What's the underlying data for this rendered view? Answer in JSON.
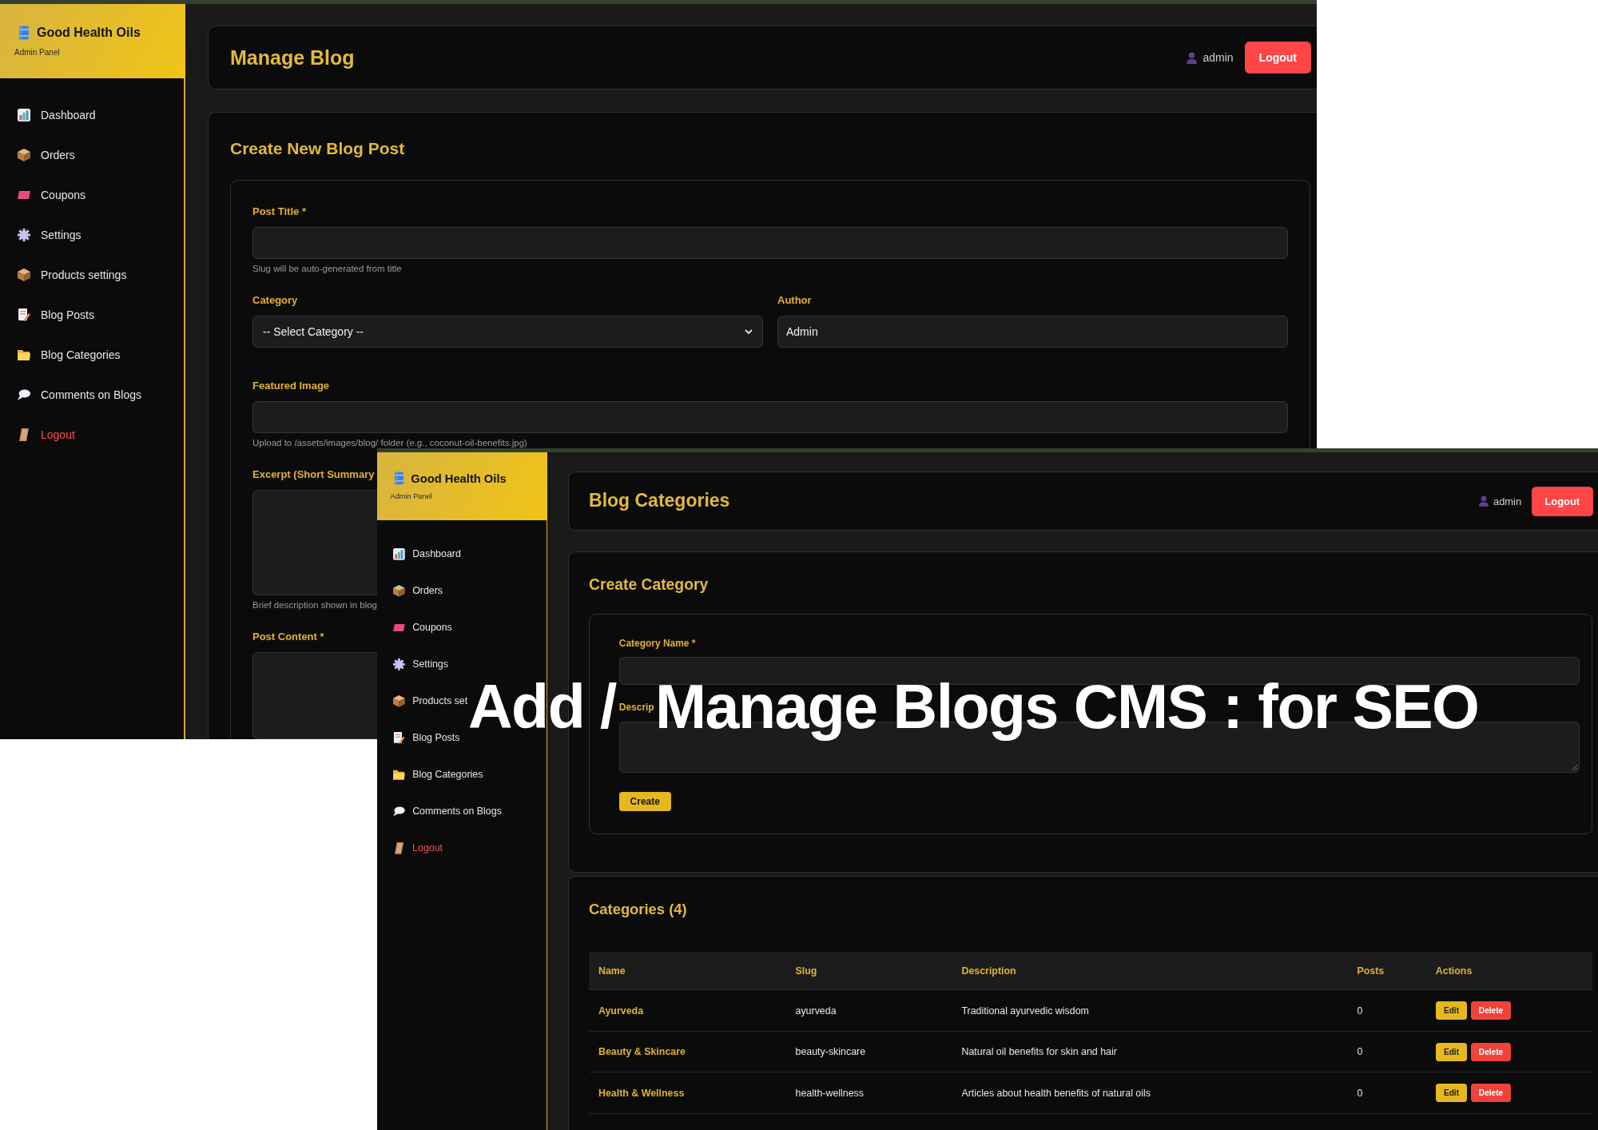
{
  "headline": [
    "Add /",
    "Manage Blogs CMS : for SEO"
  ],
  "back_window": {
    "sidebar": {
      "brand": "Good Health Oils",
      "subtitle": "Admin Panel",
      "items": [
        {
          "label": "Dashboard",
          "kind": "link"
        },
        {
          "label": "Orders",
          "kind": "link"
        },
        {
          "label": "Coupons",
          "kind": "link"
        },
        {
          "label": "Settings",
          "kind": "link"
        },
        {
          "label": "Products settings",
          "kind": "link"
        },
        {
          "label": "Blog Posts",
          "kind": "link"
        },
        {
          "label": "Blog Categories",
          "kind": "link"
        },
        {
          "label": "Comments on Blogs",
          "kind": "link"
        },
        {
          "label": "Logout",
          "kind": "logout"
        }
      ]
    },
    "header": {
      "title": "Manage Blog",
      "user": "admin",
      "logout_button": "Logout"
    },
    "form": {
      "title": "Create New Blog Post",
      "rows": [
        {
          "fields": [
            {
              "kind": "input",
              "label": "Post Title *",
              "help": "Slug will be auto-generated from title"
            }
          ]
        },
        {
          "fields": [
            {
              "kind": "select",
              "label": "Category",
              "value": "-- Select Category --"
            },
            {
              "kind": "input",
              "label": "Author",
              "value": "Admin"
            }
          ]
        },
        {
          "fields": [
            {
              "kind": "input",
              "label": "Featured Image",
              "help": "Upload to /assets/images/blog/ folder (e.g., coconut-oil-benefits.jpg)"
            }
          ]
        },
        {
          "fields": [
            {
              "kind": "textarea",
              "label": "Excerpt (Short Summary",
              "help": "Brief description shown in blog"
            }
          ]
        },
        {
          "fields": [
            {
              "kind": "textarea",
              "label": "Post Content *"
            }
          ]
        }
      ]
    }
  },
  "front_window": {
    "sidebar": {
      "brand": "Good Health Oils",
      "subtitle": "Admin Panel",
      "items": [
        {
          "label": "Dashboard",
          "kind": "link"
        },
        {
          "label": "Orders",
          "kind": "link"
        },
        {
          "label": "Coupons",
          "kind": "link"
        },
        {
          "label": "Settings",
          "kind": "link"
        },
        {
          "label": "Products set",
          "kind": "link"
        },
        {
          "label": "Blog Posts",
          "kind": "link"
        },
        {
          "label": "Blog Categories",
          "kind": "link"
        },
        {
          "label": "Comments on Blogs",
          "kind": "link"
        },
        {
          "label": "Logout",
          "kind": "logout"
        }
      ]
    },
    "header": {
      "title": "Blog Categories",
      "user": "admin",
      "logout_button": "Logout"
    },
    "form": {
      "title": "Create Category",
      "rows": [
        {
          "fields": [
            {
              "kind": "input",
              "label": "Category Name *"
            }
          ]
        },
        {
          "fields": [
            {
              "kind": "textarea",
              "label": "Descrip"
            }
          ]
        }
      ],
      "submit_button": "Create"
    },
    "table": {
      "title": "Categories (4)",
      "columns": [
        "Name",
        "Slug",
        "Description",
        "Posts",
        "Actions"
      ],
      "rows": [
        {
          "name": "Ayurveda",
          "slug": "ayurveda",
          "description": "Traditional ayurvedic wisdom",
          "posts": "0",
          "actions": [
            {
              "label": "Edit",
              "kind": "edit"
            },
            {
              "label": "Delete",
              "kind": "delete"
            }
          ]
        },
        {
          "name": "Beauty & Skincare",
          "slug": "beauty-skincare",
          "description": "Natural oil benefits for skin and hair",
          "posts": "0",
          "actions": [
            {
              "label": "Edit",
              "kind": "edit"
            },
            {
              "label": "Delete",
              "kind": "delete"
            }
          ]
        },
        {
          "name": "Health & Wellness",
          "slug": "health-wellness",
          "description": "Articles about health benefits of natural oils",
          "posts": "0",
          "actions": [
            {
              "label": "Edit",
              "kind": "edit"
            },
            {
              "label": "Delete",
              "kind": "delete"
            }
          ]
        }
      ]
    }
  }
}
